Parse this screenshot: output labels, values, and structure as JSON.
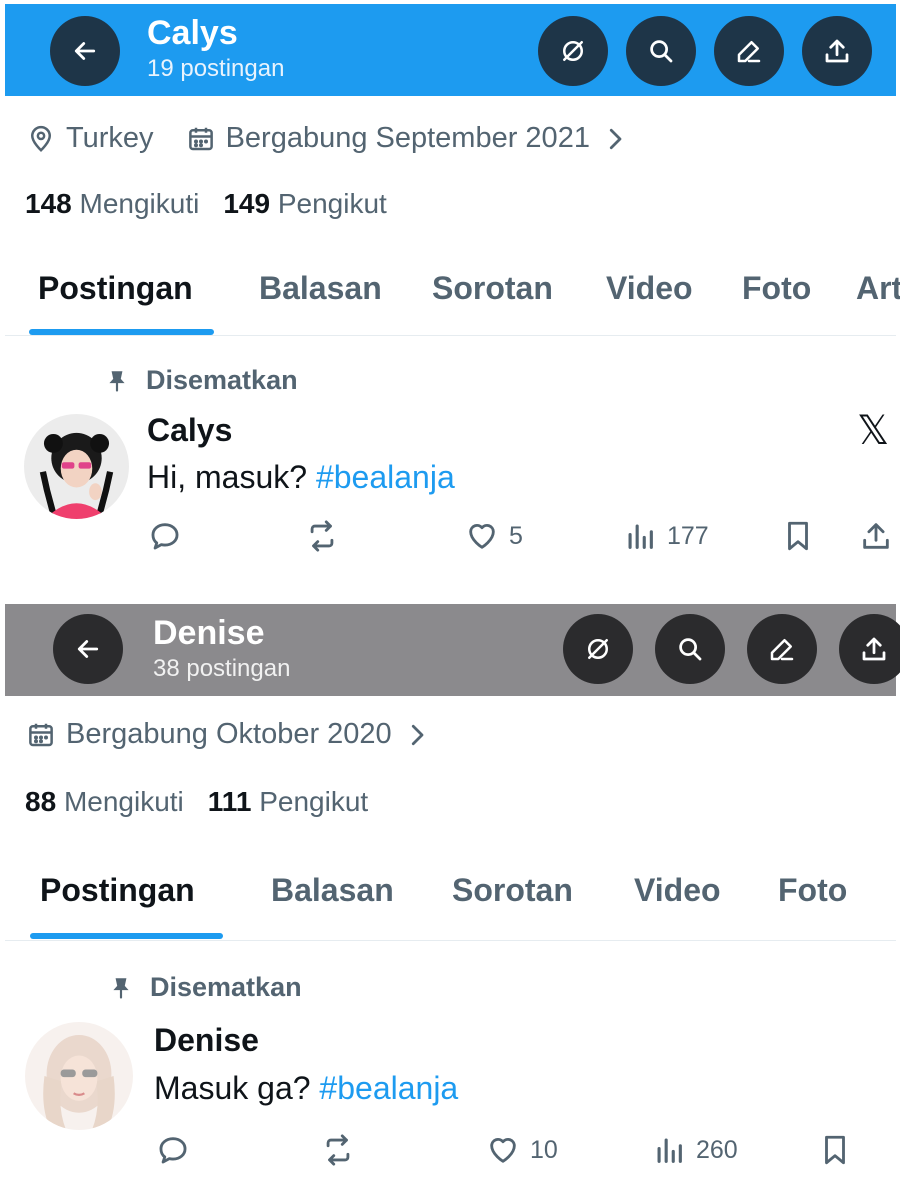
{
  "colors": {
    "brand": "#1d9bf0",
    "header_gray": "#8b8a8d",
    "text_primary": "#0f1419",
    "text_secondary": "#536471"
  },
  "profiles": [
    {
      "header": {
        "name": "Calys",
        "post_count": "19 postingan",
        "icons": [
          "back-arrow-icon",
          "grok-icon",
          "search-icon",
          "edit-icon",
          "share-icon"
        ]
      },
      "location": "Turkey",
      "joined": "Bergabung September 2021",
      "stats": {
        "following_count": "148",
        "following_label": "Mengikuti",
        "followers_count": "149",
        "followers_label": "Pengikut"
      },
      "tabs": [
        "Postingan",
        "Balasan",
        "Sorotan",
        "Video",
        "Foto",
        "Artikel"
      ],
      "active_tab": "Postingan",
      "pinned_post": {
        "pinned_label": "Disematkan",
        "author": "Calys",
        "text": "Hi, masuk?",
        "hashtag": "#bealanja",
        "likes": "5",
        "views": "177"
      }
    },
    {
      "header": {
        "name": "Denise",
        "post_count": "38 postingan",
        "icons": [
          "back-arrow-icon",
          "grok-icon",
          "search-icon",
          "edit-icon",
          "share-icon"
        ]
      },
      "joined": "Bergabung Oktober 2020",
      "stats": {
        "following_count": "88",
        "following_label": "Mengikuti",
        "followers_count": "111",
        "followers_label": "Pengikut"
      },
      "tabs": [
        "Postingan",
        "Balasan",
        "Sorotan",
        "Video",
        "Foto"
      ],
      "active_tab": "Postingan",
      "pinned_post": {
        "pinned_label": "Disematkan",
        "author": "Denise",
        "text": "Masuk ga?",
        "hashtag": "#bealanja",
        "likes": "10",
        "views": "260"
      }
    }
  ]
}
